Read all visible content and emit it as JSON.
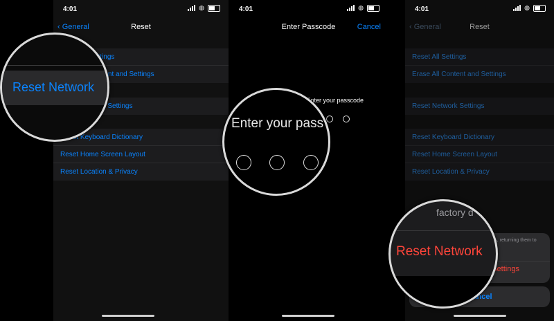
{
  "status_bar": {
    "time": "4:01"
  },
  "panel1": {
    "back_label": "General",
    "title": "Reset",
    "rows": [
      "Reset All Settings",
      "Erase All Content and Settings",
      "Reset Network Settings",
      "Reset Keyboard Dictionary",
      "Reset Home Screen Layout",
      "Reset Location & Privacy"
    ],
    "magnified_label": "Reset Network"
  },
  "panel2": {
    "title": "Enter Passcode",
    "cancel_label": "Cancel",
    "prompt": "Enter your passcode",
    "magnified_prompt": "Enter your pass"
  },
  "panel3": {
    "back_label": "General",
    "title": "Reset",
    "rows": [
      "Reset All Settings",
      "Erase All Content and Settings",
      "Reset Network Settings",
      "Reset Keyboard Dictionary",
      "Reset Home Screen Layout",
      "Reset Location & Privacy"
    ],
    "sheet_message": "This will delete all network settings, returning them to factory defaults.",
    "sheet_action": "Reset Network Settings",
    "sheet_cancel": "Cancel",
    "magnified_action": "Reset Network",
    "magnified_message": "factory d"
  },
  "colors": {
    "accent": "#0a84ff",
    "destructive": "#ff453a",
    "background": "#000000",
    "cell": "#1c1c1e"
  }
}
